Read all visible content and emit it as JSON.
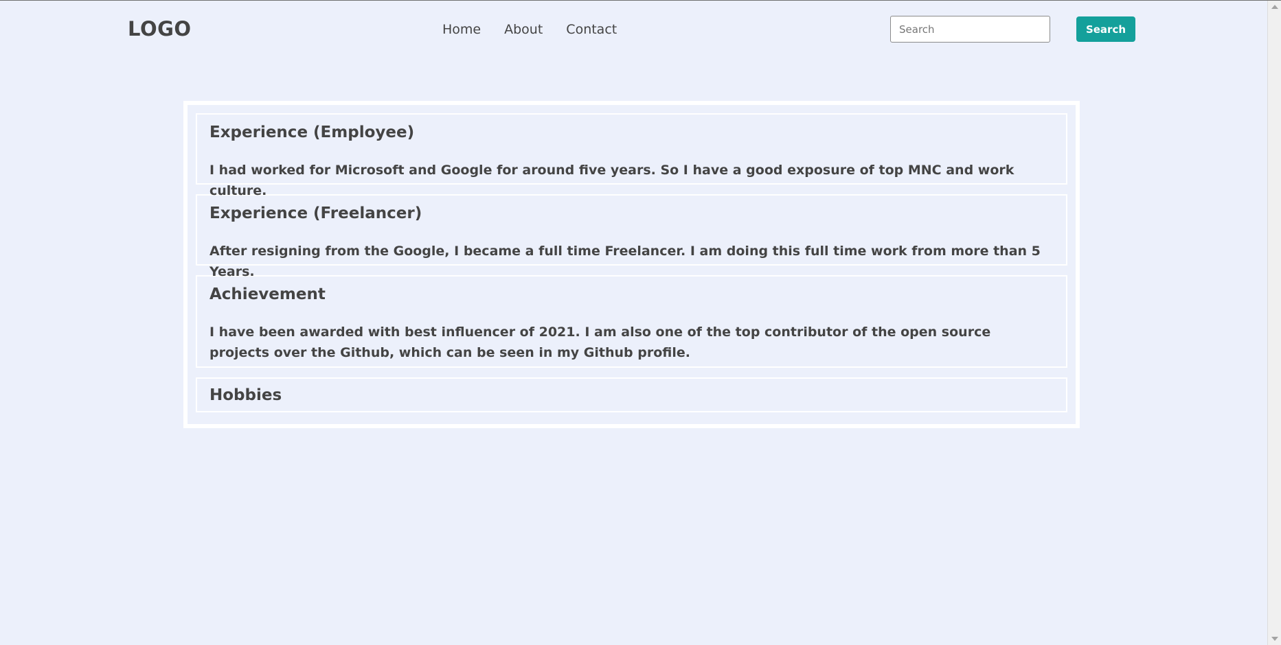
{
  "header": {
    "logo": "LOGO",
    "nav": [
      {
        "label": "Home"
      },
      {
        "label": "About"
      },
      {
        "label": "Contact"
      }
    ],
    "search": {
      "placeholder": "Search",
      "value": "",
      "button_label": "Search"
    }
  },
  "main": {
    "cards": [
      {
        "title": "Experience (Employee)",
        "text": "I had worked for Microsoft and Google for around five years. So I have a good exposure of top MNC and work culture."
      },
      {
        "title": "Experience (Freelancer)",
        "text": "After resigning from the Google, I became a full time Freelancer. I am doing this full time work from more than 5 Years."
      },
      {
        "title": "Achievement",
        "text": "I have been awarded with best influencer of 2021. I am also one of the top contributor of the open source projects over the Github, which can be seen in my Github profile."
      },
      {
        "title": "Hobbies",
        "text": ""
      }
    ]
  },
  "colors": {
    "background": "#ecf0fb",
    "text": "#444444",
    "accent": "#14a09b",
    "panel_border": "#ffffff"
  }
}
